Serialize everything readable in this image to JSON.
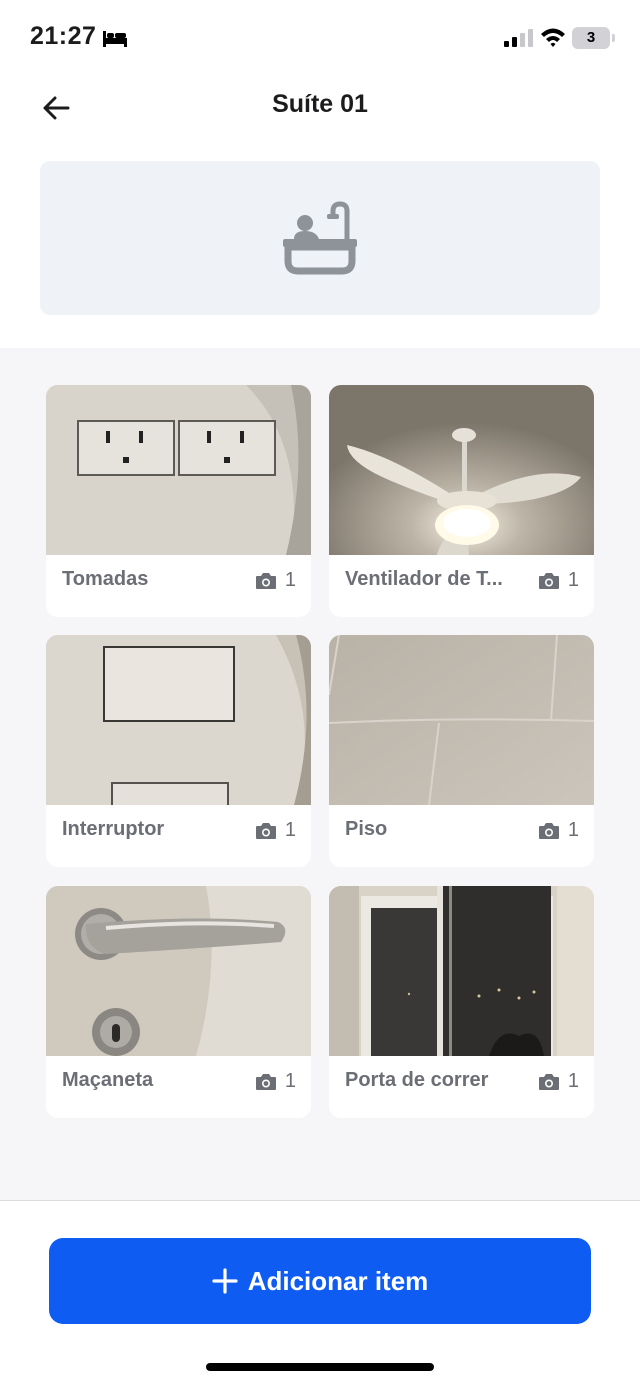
{
  "status_bar": {
    "time": "21:27",
    "battery_level": "3",
    "icons": [
      "bed-icon",
      "signal-icon",
      "wifi-icon",
      "battery-icon"
    ]
  },
  "header": {
    "title": "Suíte 01",
    "back_icon": "arrow-left-icon"
  },
  "banner": {
    "icon": "bathtub-icon"
  },
  "items": [
    {
      "label": "Tomadas",
      "photo_count": "1",
      "photo": "power-outlets"
    },
    {
      "label": "Ventilador de T...",
      "photo_count": "1",
      "photo": "ceiling-fan"
    },
    {
      "label": "Interruptor",
      "photo_count": "1",
      "photo": "light-switch"
    },
    {
      "label": "Piso",
      "photo_count": "1",
      "photo": "floor-tiles"
    },
    {
      "label": "Maçaneta",
      "photo_count": "1",
      "photo": "door-handle"
    },
    {
      "label": "Porta de correr",
      "photo_count": "1",
      "photo": "sliding-door"
    }
  ],
  "add_button": {
    "label": "Adicionar item",
    "icon": "plus-icon"
  },
  "colors": {
    "accent": "#0f5cf3",
    "banner_bg": "#eff2f6",
    "grid_bg": "#f6f6f8",
    "label_gray": "#6b6e74"
  }
}
